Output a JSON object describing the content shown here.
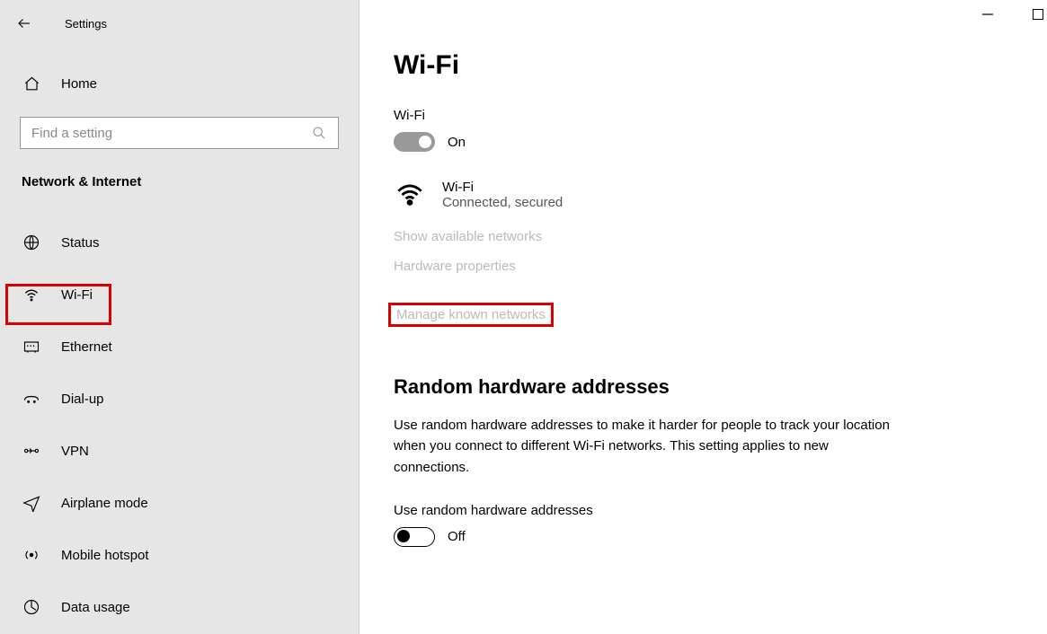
{
  "window": {
    "title": "Settings"
  },
  "sidebar": {
    "home": "Home",
    "search_placeholder": "Find a setting",
    "section": "Network & Internet",
    "items": [
      {
        "id": "status",
        "label": "Status"
      },
      {
        "id": "wifi",
        "label": "Wi-Fi"
      },
      {
        "id": "ethernet",
        "label": "Ethernet"
      },
      {
        "id": "dialup",
        "label": "Dial-up"
      },
      {
        "id": "vpn",
        "label": "VPN"
      },
      {
        "id": "airplane",
        "label": "Airplane mode"
      },
      {
        "id": "hotspot",
        "label": "Mobile hotspot"
      },
      {
        "id": "datausage",
        "label": "Data usage"
      }
    ]
  },
  "main": {
    "heading": "Wi-Fi",
    "wifi_label": "Wi-Fi",
    "wifi_toggle_state": "On",
    "connection": {
      "name": "Wi-Fi",
      "status": "Connected, secured"
    },
    "links": {
      "show_available": "Show available networks",
      "hardware_props": "Hardware properties",
      "manage_known": "Manage known networks"
    },
    "random": {
      "heading": "Random hardware addresses",
      "description": "Use random hardware addresses to make it harder for people to track your location when you connect to different Wi-Fi networks. This setting applies to new connections.",
      "toggle_label": "Use random hardware addresses",
      "toggle_state": "Off"
    }
  }
}
